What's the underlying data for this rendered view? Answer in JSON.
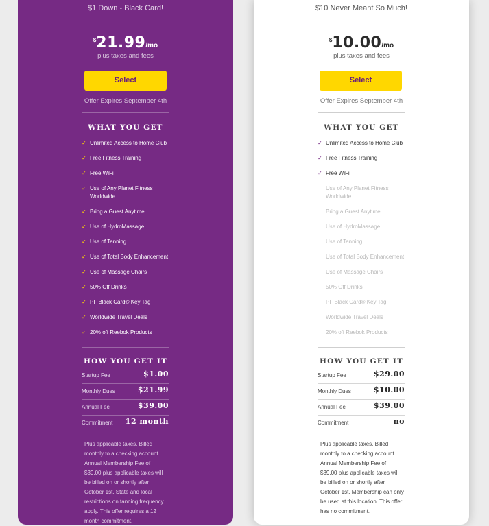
{
  "plans": {
    "black": {
      "tagline": "$1 Down - Black Card!",
      "currency": "$",
      "amount": "21.99",
      "period": "/mo",
      "taxes": "plus taxes and fees",
      "select_label": "Select",
      "expires": "Offer Expires September 4th",
      "what_title": "WHAT YOU GET",
      "features": [
        "Unlimited Access to Home Club",
        "Free Fitness Training",
        "Free WiFi",
        "Use of Any Planet Fitness Worldwide",
        "Bring a Guest Anytime",
        "Use of HydroMassage",
        "Use of Tanning",
        "Use of Total Body Enhancement",
        "Use of Massage Chairs",
        "50% Off Drinks",
        "PF Black Card® Key Tag",
        "Worldwide Travel Deals",
        "20% off Reebok Products"
      ],
      "how_title": "HOW YOU GET IT",
      "fees": [
        {
          "label": "Startup Fee",
          "value": "$1.00"
        },
        {
          "label": "Monthly Dues",
          "value": "$21.99"
        },
        {
          "label": "Annual Fee",
          "value": "$39.00"
        },
        {
          "label": "Commitment",
          "value": "12 month"
        }
      ],
      "fineprint": "Plus applicable taxes. Billed monthly to a checking account. Annual Membership Fee of $39.00 plus applicable taxes will be billed on or shortly after October 1st. State and local restrictions on tanning frequency apply. This offer requires a 12 month commitment."
    },
    "classic": {
      "tagline": "$10 Never Meant So Much!",
      "currency": "$",
      "amount": "10.00",
      "period": "/mo",
      "taxes": "plus taxes and fees",
      "select_label": "Select",
      "expires": "Offer Expires September 4th",
      "what_title": "WHAT YOU GET",
      "features": [
        "Unlimited Access to Home Club",
        "Free Fitness Training",
        "Free WiFi",
        "Use of Any Planet Fitness Worldwide",
        "Bring a Guest Anytime",
        "Use of HydroMassage",
        "Use of Tanning",
        "Use of Total Body Enhancement",
        "Use of Massage Chairs",
        "50% Off Drinks",
        "PF Black Card® Key Tag",
        "Worldwide Travel Deals",
        "20% off Reebok Products"
      ],
      "how_title": "HOW YOU GET IT",
      "fees": [
        {
          "label": "Startup Fee",
          "value": "$29.00"
        },
        {
          "label": "Monthly Dues",
          "value": "$10.00"
        },
        {
          "label": "Annual Fee",
          "value": "$39.00"
        },
        {
          "label": "Commitment",
          "value": "no"
        }
      ],
      "fineprint": "Plus applicable taxes. Billed monthly to a checking account. Annual Membership Fee of $39.00 plus applicable taxes will be billed on or shortly after October 1st. Membership can only be used at this location. This offer has no commitment."
    }
  },
  "colors": {
    "brand_purple": "#762a84",
    "button_yellow": "#ffd700",
    "included_check": "#ffd700",
    "excluded_text": "#b8b8b8"
  },
  "icons": {
    "check": "check-icon"
  }
}
